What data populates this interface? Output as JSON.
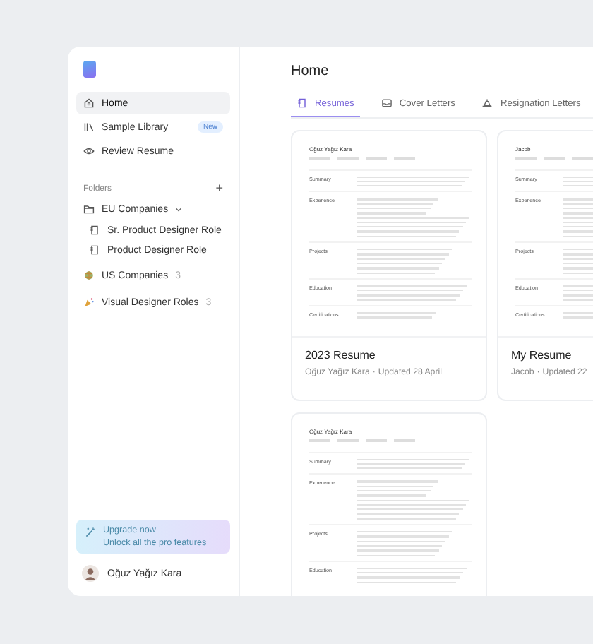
{
  "sidebar": {
    "nav": [
      {
        "label": "Home",
        "selected": true,
        "kind": "home"
      },
      {
        "label": "Sample Library",
        "selected": false,
        "kind": "library",
        "badge": "New"
      },
      {
        "label": "Review Resume",
        "selected": false,
        "kind": "review"
      }
    ],
    "folders_heading": "Folders",
    "add_symbol": "+",
    "folders": [
      {
        "label": "EU Companies",
        "kind": "folder",
        "expanded": true,
        "children": [
          {
            "label": "Sr. Product Designer Role",
            "kind": "document"
          },
          {
            "label": "Product Designer Role",
            "kind": "document"
          }
        ]
      },
      {
        "label": "US Companies",
        "kind": "emoji-globe",
        "count": "3"
      },
      {
        "label": "Visual Designer Roles",
        "kind": "emoji-party",
        "count": "3"
      }
    ],
    "upgrade": {
      "title": "Upgrade now",
      "subtitle": "Unlock all the pro features"
    },
    "user": {
      "name": "Oğuz Yağız Kara"
    }
  },
  "main": {
    "title": "Home",
    "tabs": [
      {
        "label": "Resumes",
        "selected": true,
        "kind": "resume"
      },
      {
        "label": "Cover Letters",
        "selected": false,
        "kind": "letter"
      },
      {
        "label": "Resignation Letters",
        "selected": false,
        "kind": "resign"
      }
    ],
    "cards": [
      {
        "title": "2023 Resume",
        "owner": "Oğuz Yağız Kara",
        "separator": "·",
        "updated": "Updated 28 April",
        "preview": {
          "name": "Oğuz Yağız Kara",
          "sections": [
            "Summary",
            "Experience",
            "Projects",
            "Education",
            "Certifications"
          ]
        }
      },
      {
        "title": "My Resume",
        "owner": "Jacob",
        "separator": "·",
        "updated": "Updated 22",
        "preview": {
          "name": "Jacob",
          "sections": [
            "Summary",
            "Experience",
            "Projects",
            "Education",
            "Certifications"
          ]
        }
      },
      {
        "preview": {
          "name": "Oğuz Yağız Kara",
          "sections": [
            "Summary",
            "Experience",
            "Projects",
            "Education"
          ]
        }
      }
    ]
  }
}
